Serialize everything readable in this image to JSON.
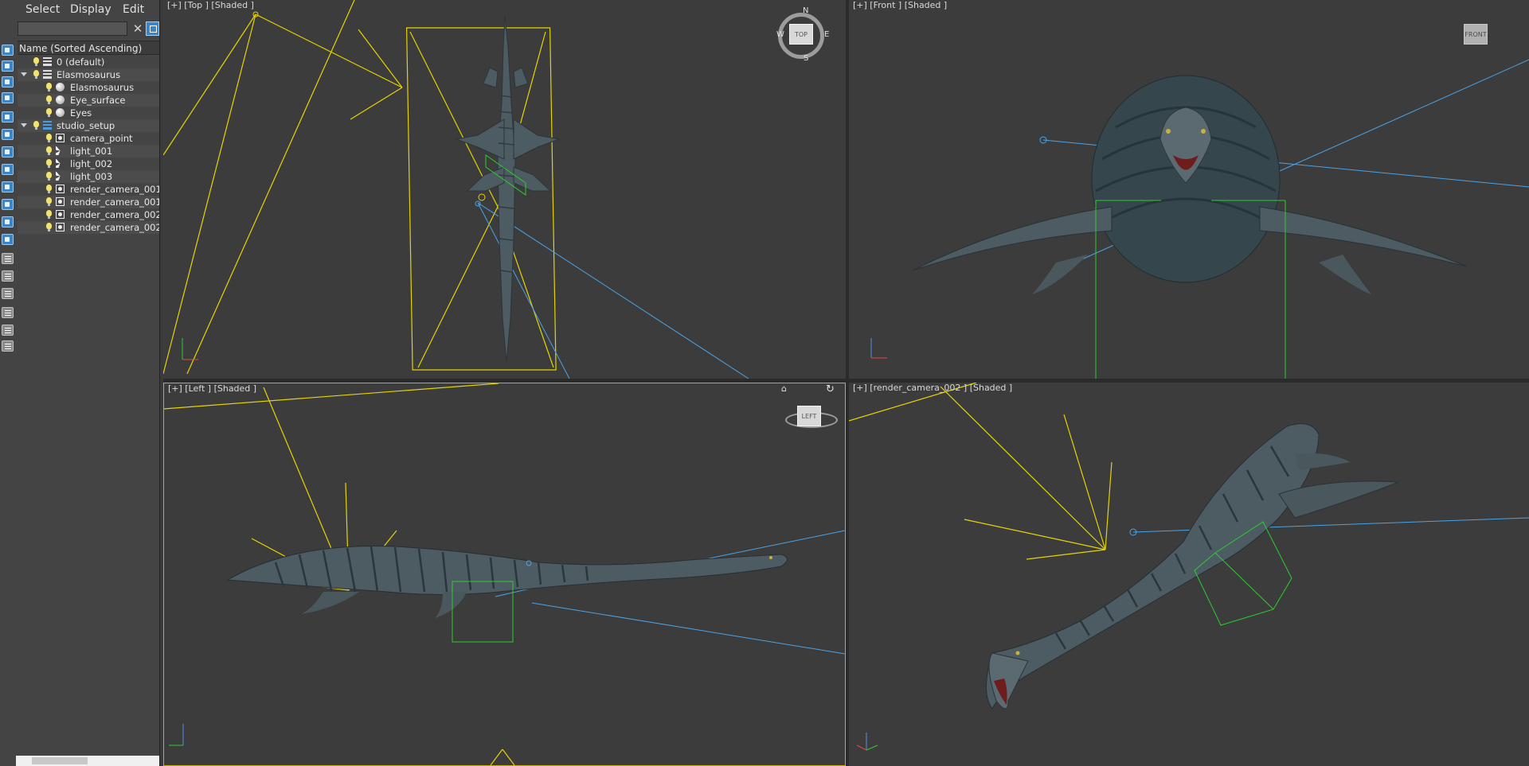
{
  "explorer": {
    "menu": {
      "select": "Select",
      "display": "Display",
      "edit": "Edit"
    },
    "search": {
      "value": "",
      "placeholder": ""
    },
    "column_header": "Name (Sorted Ascending)",
    "items": [
      {
        "label": "0 (default)",
        "icon": "layer-icon",
        "level": 1,
        "expanded": false
      },
      {
        "label": "Elasmosaurus",
        "icon": "layer-icon",
        "level": 1,
        "expanded": true
      },
      {
        "label": "Elasmosaurus",
        "icon": "sphere-icon",
        "level": 2
      },
      {
        "label": "Eye_surface",
        "icon": "sphere-icon",
        "level": 2
      },
      {
        "label": "Eyes",
        "icon": "sphere-icon",
        "level": 2
      },
      {
        "label": "studio_setup",
        "icon": "layer-icon",
        "level": 1,
        "expanded": true
      },
      {
        "label": "camera_point",
        "icon": "point-icon",
        "level": 2
      },
      {
        "label": "light_001",
        "icon": "light-icon",
        "level": 2
      },
      {
        "label": "light_002",
        "icon": "light-icon",
        "level": 2
      },
      {
        "label": "light_003",
        "icon": "light-icon",
        "level": 2
      },
      {
        "label": "render_camera_001",
        "icon": "camera-icon",
        "level": 2
      },
      {
        "label": "render_camera_001.",
        "icon": "camera-icon",
        "level": 2
      },
      {
        "label": "render_camera_002",
        "icon": "camera-icon",
        "level": 2
      },
      {
        "label": "render_camera_002.",
        "icon": "camera-icon",
        "level": 2
      }
    ]
  },
  "viewports": {
    "top": {
      "label": "[+] [Top ] [Shaded ]",
      "cube": "TOP",
      "compass": {
        "n": "N",
        "s": "S",
        "e": "E",
        "w": "W"
      }
    },
    "front": {
      "label": "[+] [Front ] [Shaded ]",
      "cube": "FRONT"
    },
    "left": {
      "label": "[+] [Left ] [Shaded ]",
      "cube": "LEFT"
    },
    "camera": {
      "label": "[+] [render_camera_002 ] [Shaded ]"
    }
  },
  "colors": {
    "light_lines": "#e6d400",
    "camera_lines": "#4aa3e6",
    "camera_frustum": "#2ecc2e",
    "creature": "#4a5a60",
    "viewport_bg": "#3c3c3c",
    "active_border": "#c7b200"
  }
}
